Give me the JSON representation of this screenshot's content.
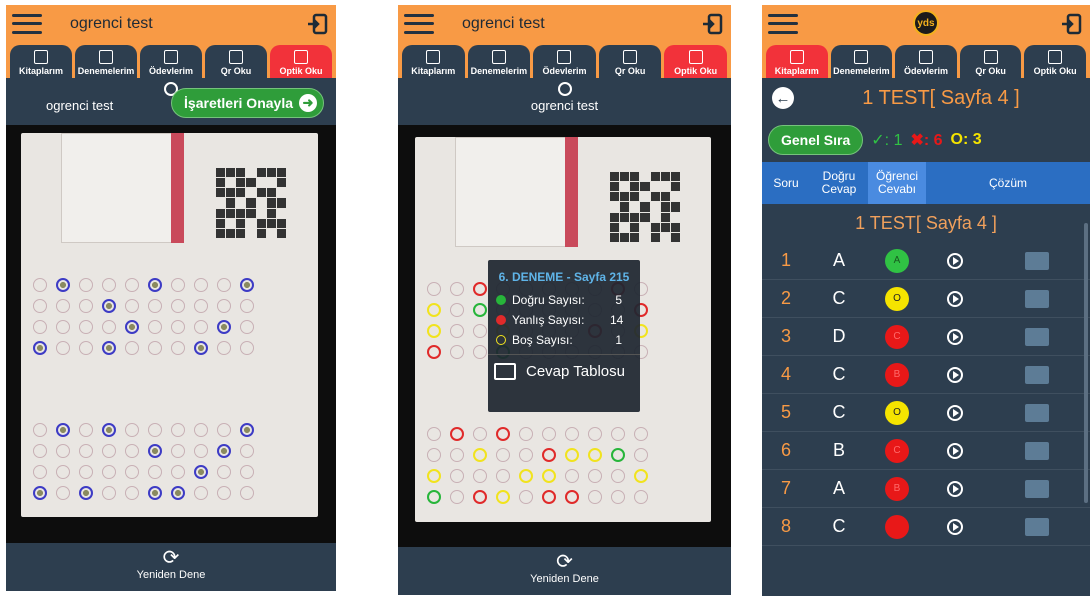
{
  "app": {
    "user_name": "ogrenci test",
    "logo_text": "yds"
  },
  "tabs": [
    {
      "label": "Kitaplarım"
    },
    {
      "label": "Denemelerim"
    },
    {
      "label": "Ödevlerim"
    },
    {
      "label": "Qr Oku"
    },
    {
      "label": "Optik Oku"
    }
  ],
  "screen1": {
    "confirm_label": "İşaretleri Onayla",
    "bottom_label": "Yeniden Dene"
  },
  "screen2": {
    "popup_title": "6. DENEME - Sayfa 215",
    "stats": [
      {
        "label": "Doğru Sayısı:",
        "value": "5",
        "color": "#27b53a"
      },
      {
        "label": "Yanlış Sayısı:",
        "value": "14",
        "color": "#e02a2a"
      },
      {
        "label": "Boş Sayısı:",
        "value": "1",
        "color": "#f1e31e"
      }
    ],
    "table_label": "Cevap Tablosu",
    "bottom_label": "Yeniden Dene"
  },
  "screen3": {
    "title": "1 TEST[ Sayfa 4 ]",
    "rank_label": "Genel Sıra",
    "correct": "✓: 1",
    "wrong": "✖: 6",
    "empty": "O: 3",
    "columns": [
      "Soru",
      "Doğru Cevap",
      "Öğrenci Cevabı",
      "Çözüm"
    ],
    "subtitle": "1 TEST[ Sayfa 4 ]",
    "rows": [
      {
        "q": "1",
        "correct": "A",
        "answer": "A",
        "status": "green"
      },
      {
        "q": "2",
        "correct": "C",
        "answer": "O",
        "status": "yellow"
      },
      {
        "q": "3",
        "correct": "D",
        "answer": "C",
        "status": "red"
      },
      {
        "q": "4",
        "correct": "C",
        "answer": "B",
        "status": "red"
      },
      {
        "q": "5",
        "correct": "C",
        "answer": "O",
        "status": "yellow"
      },
      {
        "q": "6",
        "correct": "B",
        "answer": "C",
        "status": "red"
      },
      {
        "q": "7",
        "correct": "A",
        "answer": "B",
        "status": "red"
      },
      {
        "q": "8",
        "correct": "C",
        "answer": "",
        "status": "red"
      }
    ],
    "colors": {
      "green": "#30c244",
      "yellow": "#f5e400",
      "red": "#e81818"
    }
  }
}
